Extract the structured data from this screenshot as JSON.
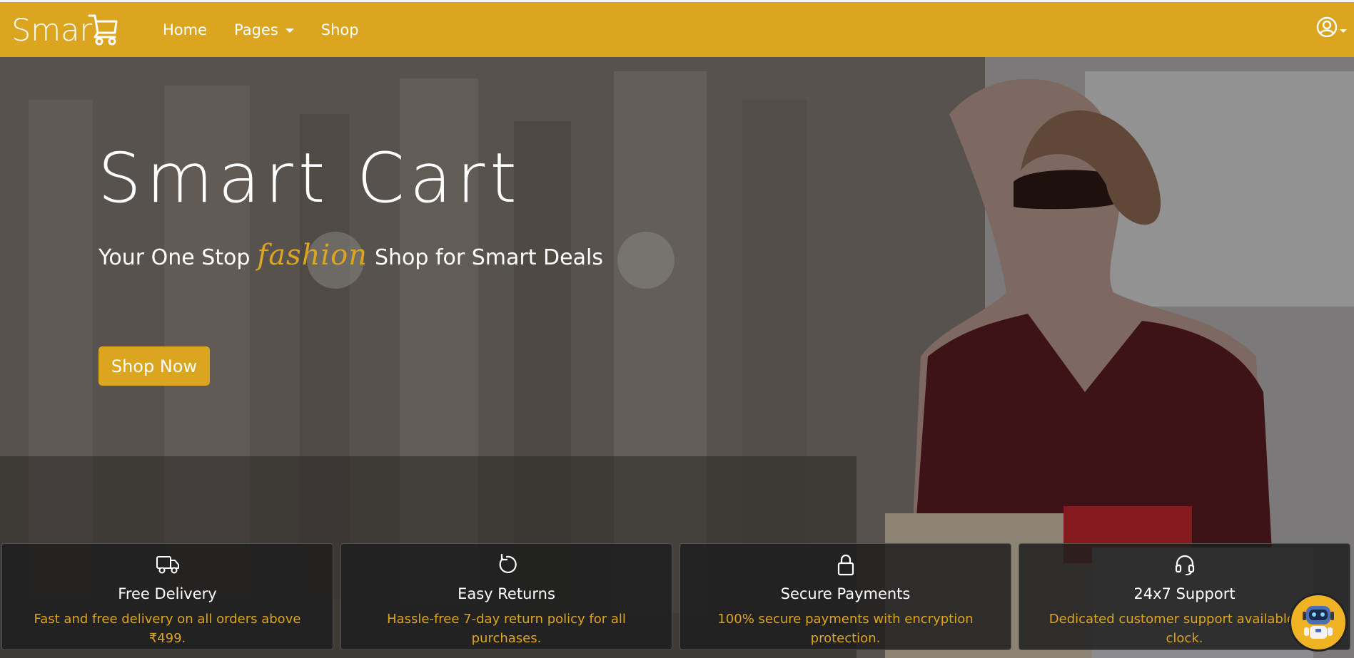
{
  "navbar": {
    "brand": "Smar",
    "links": [
      {
        "label": "Home"
      },
      {
        "label": "Pages",
        "has_dropdown": true
      },
      {
        "label": "Shop"
      }
    ],
    "user_icon": "user-circle-icon"
  },
  "hero": {
    "title": "Smart Cart",
    "tagline_before": "Your One Stop",
    "tagline_accent": "fashion",
    "tagline_after": "Shop for Smart Deals",
    "cta": "Shop Now"
  },
  "features": [
    {
      "icon": "truck-icon",
      "title": "Free Delivery",
      "description": "Fast and free delivery on all orders above ₹499."
    },
    {
      "icon": "rotate-icon",
      "title": "Easy Returns",
      "description": "Hassle-free 7-day return policy for all purchases."
    },
    {
      "icon": "lock-icon",
      "title": "Secure Payments",
      "description": "100% secure payments with encryption protection."
    },
    {
      "icon": "headset-icon",
      "title": "24x7 Support",
      "description": "Dedicated customer support available the clock."
    }
  ],
  "chatbot": {
    "icon": "robot-icon"
  },
  "colors": {
    "brand": "#dba520",
    "white": "#ffffff",
    "card_bg": "#1e1e1e"
  }
}
